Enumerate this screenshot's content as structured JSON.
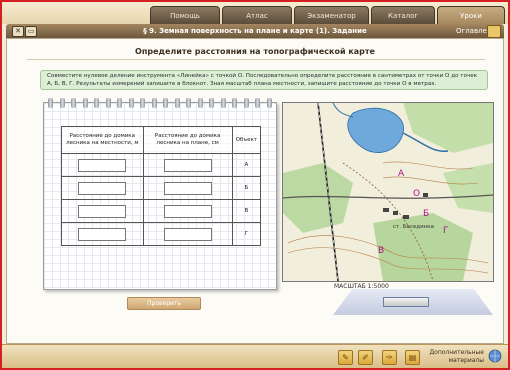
{
  "tabs": [
    {
      "label": "Помощь"
    },
    {
      "label": "Атлас"
    },
    {
      "label": "Экзаменатор"
    },
    {
      "label": "Каталог"
    },
    {
      "label": "Уроки"
    }
  ],
  "titlebar": {
    "title": "§ 9. Земная поверхность на плане и карте (1). Задание",
    "book_label": "Оглавление",
    "close_symbol": "✕",
    "min_symbol": "▭"
  },
  "task": {
    "heading": "Определите расстояния на топографической карте",
    "instruction": "Совместите нулевое деление инструмента «Линейка» с точкой О. Последовательно определите расстояние в сантиметрах от точки О до точек А, Б, В, Г. Результаты измерений запишите в блокнот. Зная масштаб плана местности, запишите расстояние до точки О в метрах."
  },
  "table": {
    "headers": [
      "Объект",
      "Расстояние до домика лесника на плане, см",
      "Расстояние до домика лесника на местности, м"
    ],
    "rows": [
      {
        "label": "А",
        "plan": "",
        "real": ""
      },
      {
        "label": "Б",
        "plan": "",
        "real": ""
      },
      {
        "label": "В",
        "plan": "",
        "real": ""
      },
      {
        "label": "Г",
        "plan": "",
        "real": ""
      }
    ]
  },
  "check_button": "Проверить",
  "map": {
    "scale_label": "МАСШТАБ 1:5000",
    "town_label": "ст. Бесединка",
    "points": [
      "А",
      "Б",
      "В",
      "Г",
      "О"
    ]
  },
  "bottom": {
    "extra_label": "Дополнительные материалы"
  },
  "colors": {
    "frame": "#d42020",
    "tab_dark": "#5b4c39",
    "tab_active": "#a68a5f",
    "instruction_bg": "#dcefd6"
  }
}
